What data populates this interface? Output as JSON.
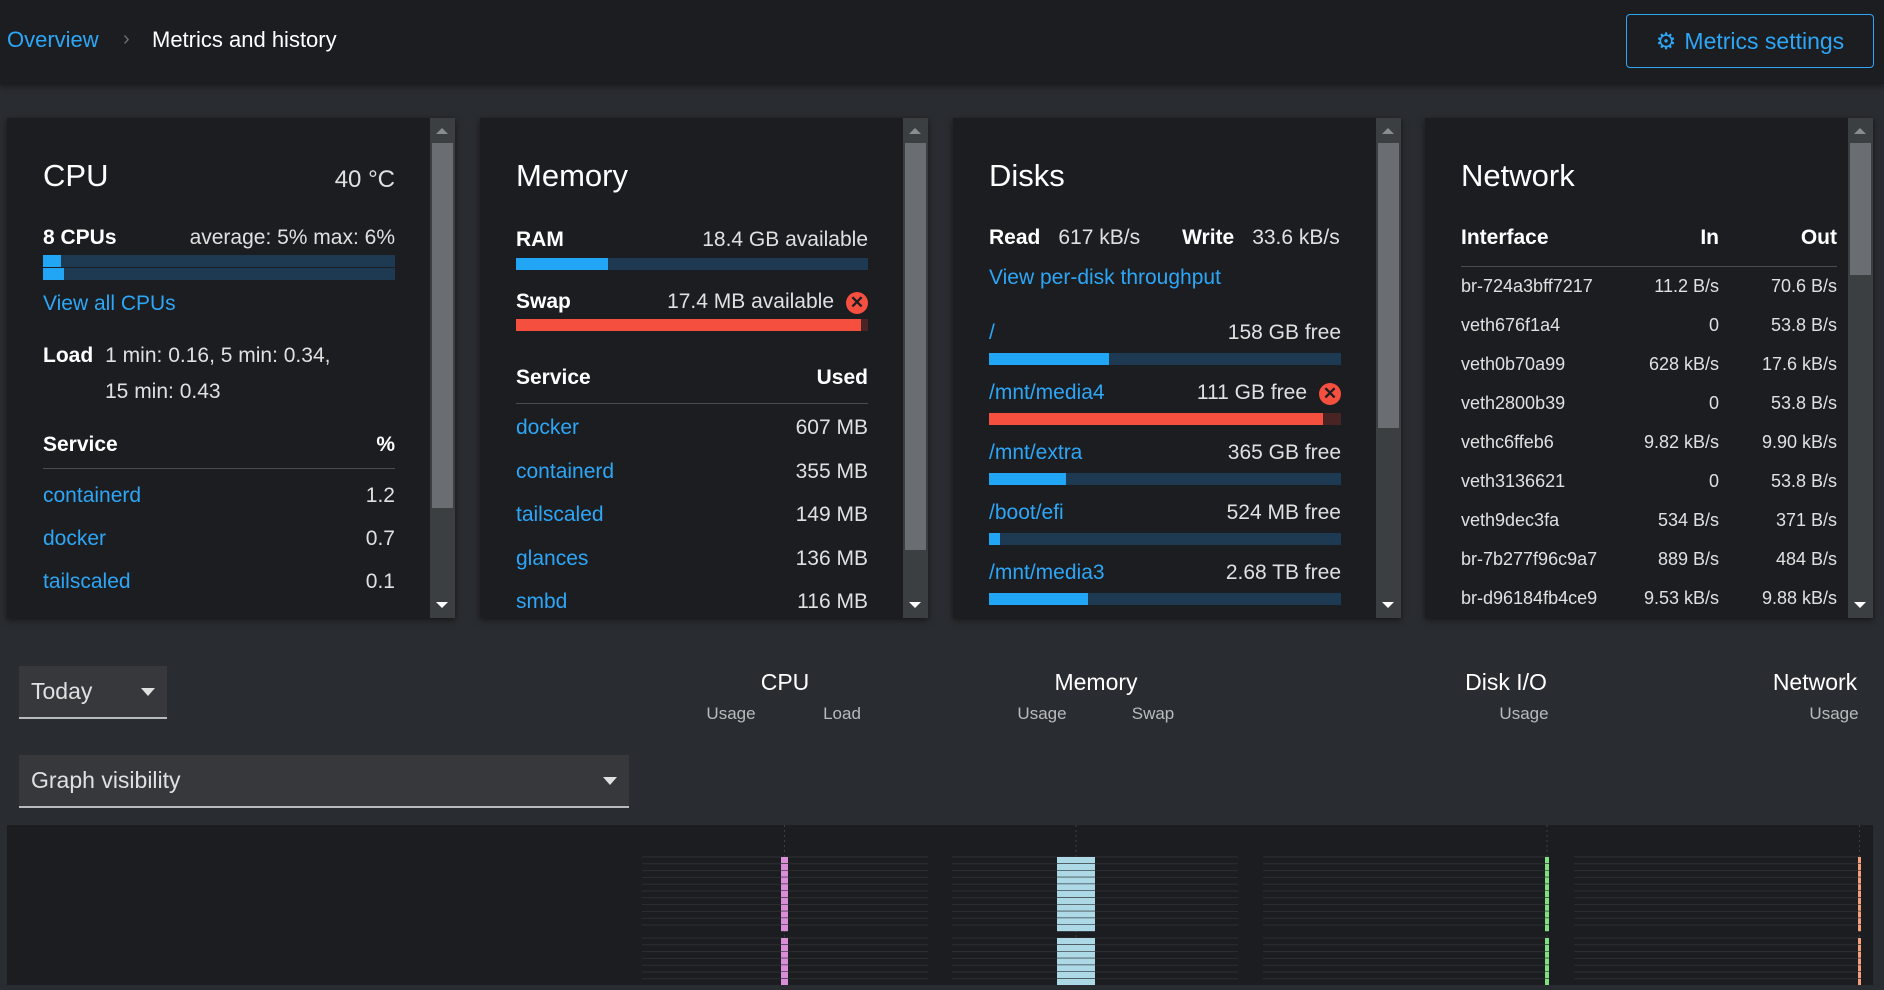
{
  "header": {
    "breadcrumb_root": "Overview",
    "breadcrumb_current": "Metrics and history",
    "settings_button": "Metrics settings"
  },
  "cpu": {
    "title": "CPU",
    "temperature": "40 °C",
    "count": "8 CPUs",
    "avg_max": "average: 5% max: 6%",
    "usage_fill": [
      0.05,
      0.06
    ],
    "view_all": "View all CPUs",
    "load_label": "Load",
    "load_line1": "1 min: 0.16, 5 min: 0.34,",
    "load_line2": "15 min: 0.43",
    "col_service": "Service",
    "col_pct": "%",
    "services": [
      {
        "name": "containerd",
        "value": "1.2"
      },
      {
        "name": "docker",
        "value": "0.7"
      },
      {
        "name": "tailscaled",
        "value": "0.1"
      }
    ]
  },
  "memory": {
    "title": "Memory",
    "ram_label": "RAM",
    "ram_value": "18.4 GB available",
    "ram_fill": 0.26,
    "swap_label": "Swap",
    "swap_value": "17.4 MB available",
    "swap_fill": 0.98,
    "col_service": "Service",
    "col_used": "Used",
    "services": [
      {
        "name": "docker",
        "value": "607 MB"
      },
      {
        "name": "containerd",
        "value": "355 MB"
      },
      {
        "name": "tailscaled",
        "value": "149 MB"
      },
      {
        "name": "glances",
        "value": "136 MB"
      },
      {
        "name": "smbd",
        "value": "116 MB"
      }
    ]
  },
  "disks": {
    "title": "Disks",
    "read_label": "Read",
    "read_value": "617 kB/s",
    "write_label": "Write",
    "write_value": "33.6 kB/s",
    "per_disk_link": "View per-disk throughput",
    "items": [
      {
        "name": "/",
        "free": "158 GB free",
        "fill": 0.34,
        "error": false
      },
      {
        "name": "/mnt/media4",
        "free": "111 GB free",
        "fill": 0.95,
        "error": true
      },
      {
        "name": "/mnt/extra",
        "free": "365 GB free",
        "fill": 0.22,
        "error": false
      },
      {
        "name": "/boot/efi",
        "free": "524 MB free",
        "fill": 0.03,
        "error": false
      },
      {
        "name": "/mnt/media3",
        "free": "2.68 TB free",
        "fill": 0.28,
        "error": false
      }
    ]
  },
  "network": {
    "title": "Network",
    "col_iface": "Interface",
    "col_in": "In",
    "col_out": "Out",
    "rows": [
      {
        "iface": "br-724a3bff7217",
        "in": "11.2 B/s",
        "out": "70.6 B/s"
      },
      {
        "iface": "veth676f1a4",
        "in": "0",
        "out": "53.8 B/s"
      },
      {
        "iface": "veth0b70a99",
        "in": "628 kB/s",
        "out": "17.6 kB/s"
      },
      {
        "iface": "veth2800b39",
        "in": "0",
        "out": "53.8 B/s"
      },
      {
        "iface": "vethc6ffeb6",
        "in": "9.82 kB/s",
        "out": "9.90 kB/s"
      },
      {
        "iface": "veth3136621",
        "in": "0",
        "out": "53.8 B/s"
      },
      {
        "iface": "veth9dec3fa",
        "in": "534 B/s",
        "out": "371 B/s"
      },
      {
        "iface": "br-7b277f96c9a7",
        "in": "889 B/s",
        "out": "484 B/s"
      },
      {
        "iface": "br-d96184fb4ce9",
        "in": "9.53 kB/s",
        "out": "9.88 kB/s"
      }
    ]
  },
  "history": {
    "range": "Today",
    "graph_visibility": "Graph visibility",
    "columns": [
      {
        "title": "CPU",
        "subs": [
          "Usage",
          "Load"
        ]
      },
      {
        "title": "Memory",
        "subs": [
          "Usage",
          "Swap"
        ]
      },
      {
        "title": "Disk I/O",
        "subs": [
          "Usage"
        ]
      },
      {
        "title": "Network",
        "subs": [
          "Usage"
        ]
      }
    ],
    "colors": {
      "cpu": "#d88fd8",
      "memory": "#add8e6",
      "disk": "#7ee07e",
      "network": "#f4a07a"
    }
  }
}
